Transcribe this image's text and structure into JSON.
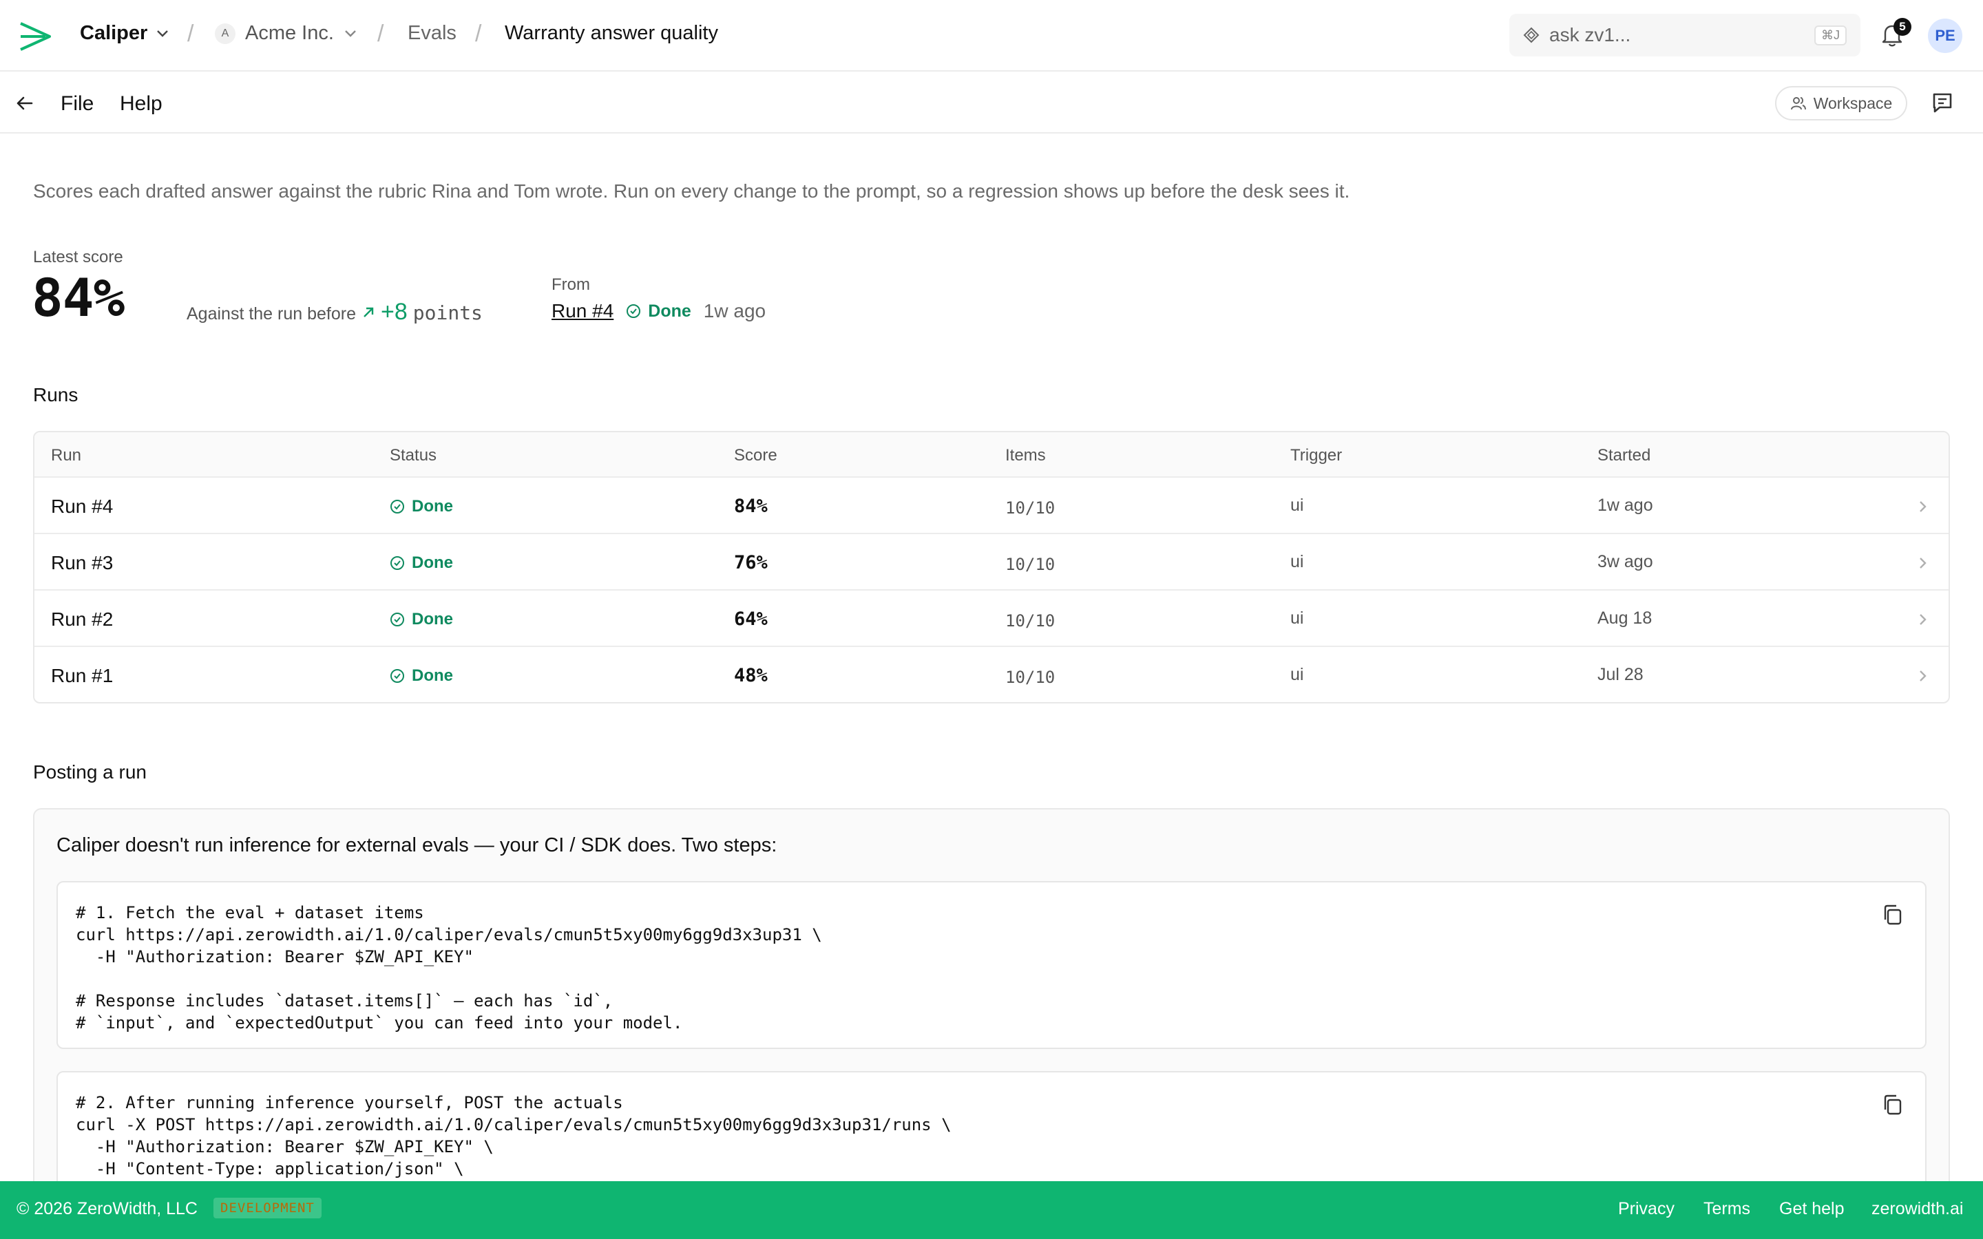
{
  "header": {
    "app_name": "Caliper",
    "org": "Acme Inc.",
    "org_initial": "A",
    "breadcrumb_section": "Evals",
    "breadcrumb_current": "Warranty answer quality",
    "search_placeholder": "ask zv1...",
    "search_shortcut": "⌘J",
    "notification_count": "5",
    "user_initials": "PE"
  },
  "menubar": {
    "file_label": "File",
    "help_label": "Help",
    "workspace_label": "Workspace"
  },
  "description": "Scores each drafted answer against the rubric Rina and Tom wrote. Run on every change to the prompt, so a regression shows up before the desk sees it.",
  "score": {
    "label": "Latest score",
    "value": "84%",
    "against_label": "Against the run before",
    "delta": "+8",
    "delta_unit": "points",
    "from_label": "From",
    "from_run": "Run #4",
    "from_status": "Done",
    "from_ago": "1w ago"
  },
  "runs": {
    "title": "Runs",
    "columns": [
      "Run",
      "Status",
      "Score",
      "Items",
      "Trigger",
      "Started"
    ],
    "rows": [
      {
        "run": "Run #4",
        "status": "Done",
        "score": "84%",
        "items": "10/10",
        "trigger": "ui",
        "started": "1w ago"
      },
      {
        "run": "Run #3",
        "status": "Done",
        "score": "76%",
        "items": "10/10",
        "trigger": "ui",
        "started": "3w ago"
      },
      {
        "run": "Run #2",
        "status": "Done",
        "score": "64%",
        "items": "10/10",
        "trigger": "ui",
        "started": "Aug 18"
      },
      {
        "run": "Run #1",
        "status": "Done",
        "score": "48%",
        "items": "10/10",
        "trigger": "ui",
        "started": "Jul 28"
      }
    ]
  },
  "posting": {
    "title": "Posting a run",
    "intro": "Caliper doesn't run inference for external evals — your CI / SDK does. Two steps:",
    "step1": "# 1. Fetch the eval + dataset items\ncurl https://api.zerowidth.ai/1.0/caliper/evals/cmun5t5xy00my6gg9d3x3up31 \\\n  -H \"Authorization: Bearer $ZW_API_KEY\"\n\n# Response includes `dataset.items[]` — each has `id`,\n# `input`, and `expectedOutput` you can feed into your model.",
    "step2": "# 2. After running inference yourself, POST the actuals\ncurl -X POST https://api.zerowidth.ai/1.0/caliper/evals/cmun5t5xy00my6gg9d3x3up31/runs \\\n  -H \"Authorization: Bearer $ZW_API_KEY\" \\\n  -H \"Content-Type: application/json\" \\"
  },
  "footer": {
    "copyright": "© 2026 ZeroWidth, LLC",
    "env_badge": "DEVELOPMENT",
    "links": [
      "Privacy",
      "Terms",
      "Get help",
      "zerowidth.ai"
    ]
  },
  "colors": {
    "accent_green": "#0fb571",
    "status_green": "#0f8a5f",
    "delta_green": "#0f9d68"
  }
}
